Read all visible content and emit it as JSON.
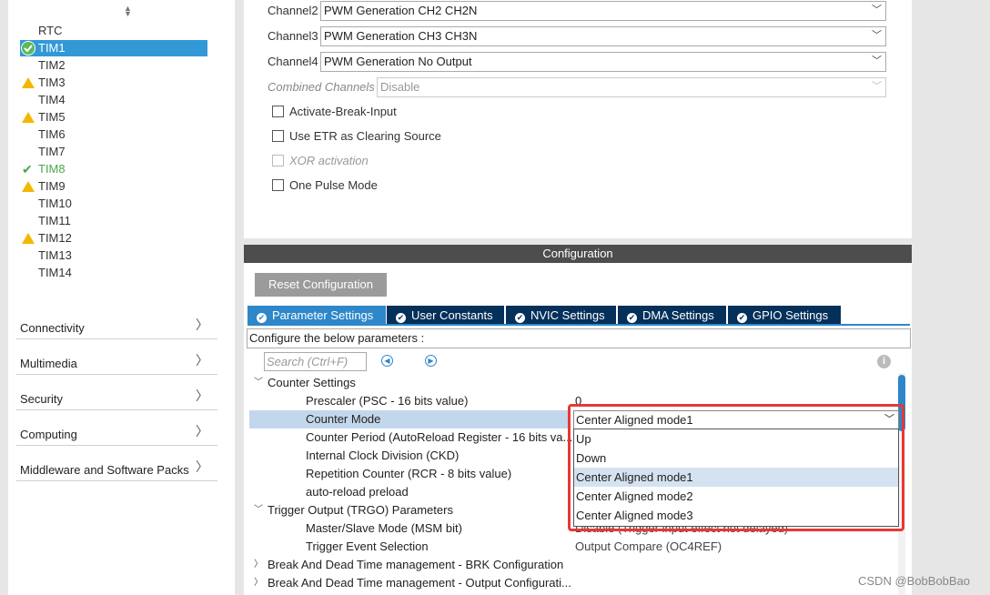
{
  "sidebar": {
    "timers": [
      {
        "label": "RTC",
        "status": "none"
      },
      {
        "label": "TIM1",
        "status": "selected"
      },
      {
        "label": "TIM2",
        "status": "none"
      },
      {
        "label": "TIM3",
        "status": "warning"
      },
      {
        "label": "TIM4",
        "status": "none"
      },
      {
        "label": "TIM5",
        "status": "warning"
      },
      {
        "label": "TIM6",
        "status": "none"
      },
      {
        "label": "TIM7",
        "status": "none"
      },
      {
        "label": "TIM8",
        "status": "ok"
      },
      {
        "label": "TIM9",
        "status": "warning"
      },
      {
        "label": "TIM10",
        "status": "none"
      },
      {
        "label": "TIM11",
        "status": "none"
      },
      {
        "label": "TIM12",
        "status": "warning"
      },
      {
        "label": "TIM13",
        "status": "none"
      },
      {
        "label": "TIM14",
        "status": "none"
      }
    ],
    "categories": [
      {
        "label": "Connectivity"
      },
      {
        "label": "Multimedia"
      },
      {
        "label": "Security"
      },
      {
        "label": "Computing"
      },
      {
        "label": "Middleware and Software Packs"
      }
    ]
  },
  "mode": {
    "channels": [
      {
        "label": "Channel2",
        "value": "PWM Generation CH2 CH2N"
      },
      {
        "label": "Channel3",
        "value": "PWM Generation CH3 CH3N"
      },
      {
        "label": "Channel4",
        "value": "PWM Generation No Output"
      }
    ],
    "combined": {
      "label": "Combined Channels",
      "value": "Disable"
    },
    "checkboxes": [
      {
        "label": "Activate-Break-Input",
        "disabled": false
      },
      {
        "label": "Use ETR as Clearing Source",
        "disabled": false
      },
      {
        "label": "XOR activation",
        "disabled": true
      },
      {
        "label": "One Pulse Mode",
        "disabled": false
      }
    ]
  },
  "configuration": {
    "title": "Configuration",
    "reset_label": "Reset Configuration",
    "tabs": [
      {
        "label": "Parameter Settings",
        "active": true
      },
      {
        "label": "User Constants",
        "active": false
      },
      {
        "label": "NVIC Settings",
        "active": false
      },
      {
        "label": "DMA Settings",
        "active": false
      },
      {
        "label": "GPIO Settings",
        "active": false
      }
    ],
    "configure_text": "Configure the below parameters :",
    "search_placeholder": "Search (Ctrl+F)"
  },
  "params": {
    "counter_settings": "Counter Settings",
    "prescaler": {
      "label": "Prescaler (PSC - 16 bits value)",
      "value": "0"
    },
    "counter_mode": {
      "label": "Counter Mode",
      "value": "Center Aligned mode1"
    },
    "counter_period": {
      "label": "Counter Period (AutoReload Register - 16 bits va..."
    },
    "clock_division": {
      "label": "Internal Clock Division (CKD)"
    },
    "repetition": {
      "label": "Repetition Counter (RCR - 8 bits value)"
    },
    "autoreload": {
      "label": "auto-reload preload"
    },
    "trgo": "Trigger Output (TRGO) Parameters",
    "master_slave": {
      "label": "Master/Slave Mode (MSM bit)",
      "value": "Disable (Trigger input effect not delayed)"
    },
    "trigger_event": {
      "label": "Trigger Event Selection",
      "value": "Output Compare (OC4REF)"
    },
    "brk": "Break And Dead Time management - BRK Configuration",
    "output_cfg": "Break And Dead Time management - Output Configurati..."
  },
  "dropdown": {
    "options": [
      "Up",
      "Down",
      "Center Aligned mode1",
      "Center Aligned mode2",
      "Center Aligned mode3"
    ],
    "selected": "Center Aligned mode1"
  },
  "watermark": "CSDN @BobBobBao",
  "colors": {
    "accent": "#2d87c8",
    "tab_dark": "#05305a",
    "warning": "#f2b800",
    "ok": "#4aa84a",
    "highlight": "#e53935"
  }
}
